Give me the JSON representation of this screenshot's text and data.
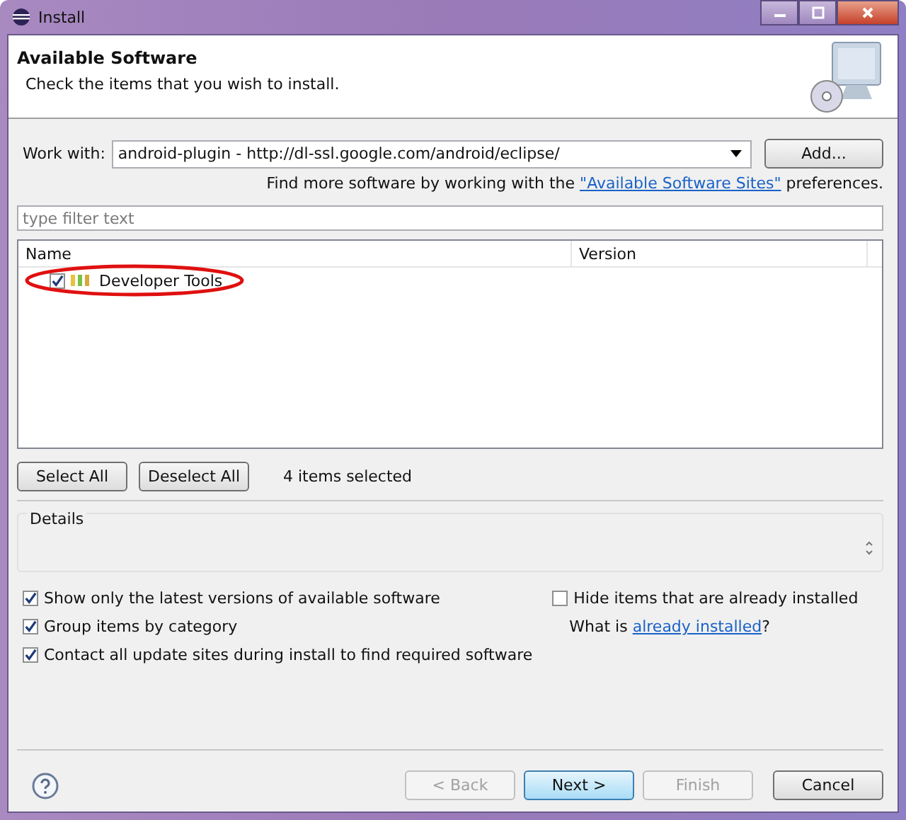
{
  "window": {
    "title": "Install"
  },
  "header": {
    "title": "Available Software",
    "subtitle": "Check the items that you wish to install."
  },
  "work_with": {
    "label": "Work with:",
    "value": "android-plugin - http://dl-ssl.google.com/android/eclipse/",
    "add_button": "Add..."
  },
  "more_software": {
    "before": "Find more software by working with the",
    "link": "\"Available Software Sites\"",
    "after": "preferences."
  },
  "filter": {
    "placeholder": "type filter text"
  },
  "tree": {
    "columns": [
      "Name",
      "Version"
    ],
    "rows": [
      {
        "name": "Developer Tools",
        "checked": true,
        "highlighted": true
      }
    ]
  },
  "selection_buttons": [
    "Select All",
    "Deselect All"
  ],
  "selection_count": "4 items selected",
  "details": {
    "title": "Details"
  },
  "options": [
    {
      "label": "Show only the latest versions of available software",
      "checked": true
    },
    {
      "label": "Hide items that are already installed",
      "checked": false
    },
    {
      "label": "Group items by category",
      "checked": true
    },
    {
      "label": "Contact all update sites during install to find required software",
      "checked": true
    }
  ],
  "installed_hint": {
    "before": "What is",
    "link": "already installed",
    "after": "?"
  },
  "buttons": [
    {
      "label": "< Back",
      "disabled": true,
      "default": false
    },
    {
      "label": "Next >",
      "disabled": false,
      "default": true
    },
    {
      "label": "Finish",
      "disabled": true,
      "default": false
    },
    {
      "label": "Cancel",
      "disabled": false,
      "default": false
    }
  ]
}
